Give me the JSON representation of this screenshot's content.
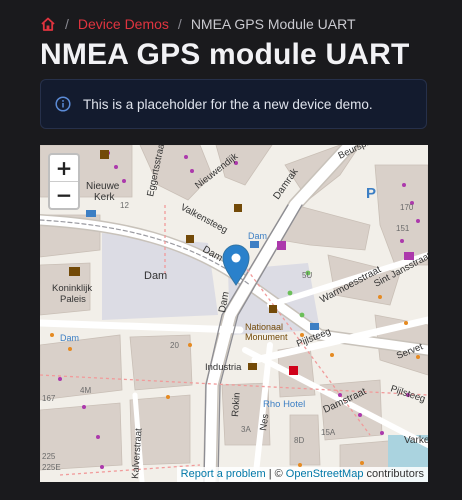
{
  "breadcrumb": {
    "home_icon": "home-icon",
    "items": [
      "Device Demos",
      "NMEA GPS Module UART"
    ]
  },
  "page": {
    "title": "NMEA GPS module UART"
  },
  "alert": {
    "icon": "info-icon",
    "text": "This is a placeholder for the a new device demo."
  },
  "map": {
    "zoom_in": "+",
    "zoom_out": "−",
    "attribution": {
      "report": "Report a problem",
      "separator": "| ©",
      "osm": "OpenStreetMap",
      "contributors": "contributors"
    },
    "labels": {
      "eggerts": "Eggertsstraat",
      "nieuwe_kerk_1": "Nieuwe",
      "nieuwe_kerk_2": "Kerk",
      "nieuwendijk": "Nieuwendijk",
      "valkensteeg": "Valkensteeg",
      "damrak": "Damrak",
      "beursplein": "Beursplein",
      "dam_small": "Dam",
      "dam_main": "Dam",
      "dam_road": "Dam",
      "dam_vertical": "Dam",
      "dam_left": "Dam",
      "koninklijk_1": "Koninklijk",
      "koninklijk_2": "Paleis",
      "warmoesstraat": "Warmoesstraat",
      "sint_jansstraat": "Sint Jansstraat",
      "nationaal_1": "Nationaal",
      "nationaal_2": "Monument",
      "pijlsteeg": "Pijlsteeg",
      "servet": "Servet",
      "pijlsteeg2": "Pijlsteeg",
      "damstraat": "Damstraat",
      "industria": "Industria",
      "rho_hotel": "Rho Hotel",
      "rokin": "Rokin",
      "nes": "Nes",
      "kalverstraat": "Kalverstraat",
      "varke": "Varke",
      "n_170": "170",
      "n_151": "151",
      "n_12": "12",
      "n_20": "20",
      "n_4m": "4M",
      "n_167": "167",
      "n_225": "225",
      "n_225e": "225E",
      "n_3a": "3A",
      "n_8d": "8D",
      "n_15a": "15A",
      "n_5u": "5U",
      "p_sign": "P"
    },
    "colors": {
      "land": "#f2efe9",
      "building": "#d9d0c9",
      "square": "#dcdce4",
      "road_major": "#ffffff",
      "road_casing": "#c8c2ba",
      "label": "#333333",
      "marker": "#2a81cb",
      "water": "#aad3df"
    }
  }
}
